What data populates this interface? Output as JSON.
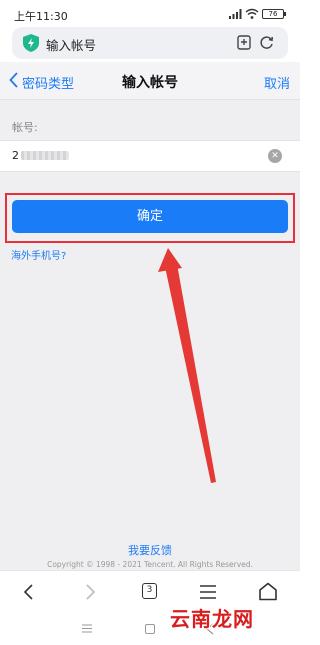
{
  "status_bar": {
    "time": "上午11:30",
    "battery": "76"
  },
  "address_bar": {
    "title": "输入帐号"
  },
  "nav": {
    "back_label": "密码类型",
    "title": "输入帐号",
    "cancel_label": "取消"
  },
  "form": {
    "account_label": "帐号:",
    "account_value": "2",
    "confirm_label": "确定",
    "overseas_link": "海外手机号?"
  },
  "footer": {
    "feedback_link": "我要反馈",
    "copyright": "Copyright © 1998 - 2021 Tencent. All Rights Reserved."
  },
  "toolbar": {
    "tab_count": "3"
  },
  "watermark": "云南龙网",
  "colors": {
    "accent": "#1b7cf7",
    "highlight": "#e8303c"
  }
}
